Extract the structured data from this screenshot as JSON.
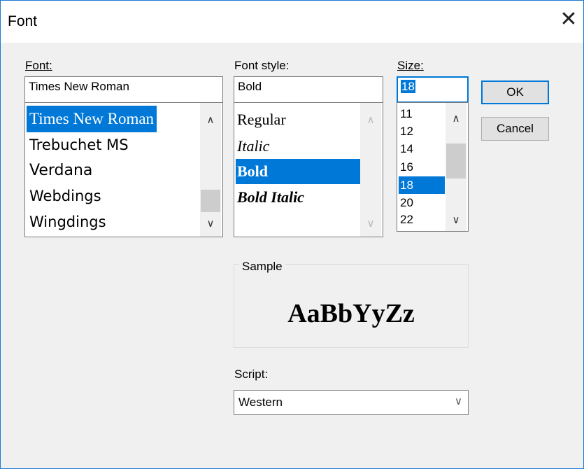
{
  "window": {
    "title": "Font",
    "close_glyph": "✕"
  },
  "font": {
    "label": "Font:",
    "value": "Times New Roman",
    "items": [
      "Times New Roman",
      "Trebuchet MS",
      "Verdana",
      "Webdings",
      "Wingdings"
    ],
    "selected_index": 0
  },
  "font_style": {
    "label": "Font style:",
    "value": "Bold",
    "items": [
      "Regular",
      "Italic",
      "Bold",
      "Bold Italic"
    ],
    "selected_index": 2
  },
  "size": {
    "label": "Size:",
    "value": "18",
    "items": [
      "11",
      "12",
      "14",
      "16",
      "18",
      "20",
      "22"
    ],
    "selected_index": 4
  },
  "buttons": {
    "ok": "OK",
    "cancel": "Cancel"
  },
  "sample": {
    "label": "Sample",
    "text": "AaBbYyZz"
  },
  "script": {
    "label": "Script:",
    "value": "Western"
  },
  "colors": {
    "accent": "#0078d7",
    "window_border": "#1f7bd3"
  },
  "icons": {
    "close": "close-icon",
    "scroll_up": "chevron-up-icon",
    "scroll_down": "chevron-down-icon",
    "dropdown": "chevron-down-icon"
  }
}
